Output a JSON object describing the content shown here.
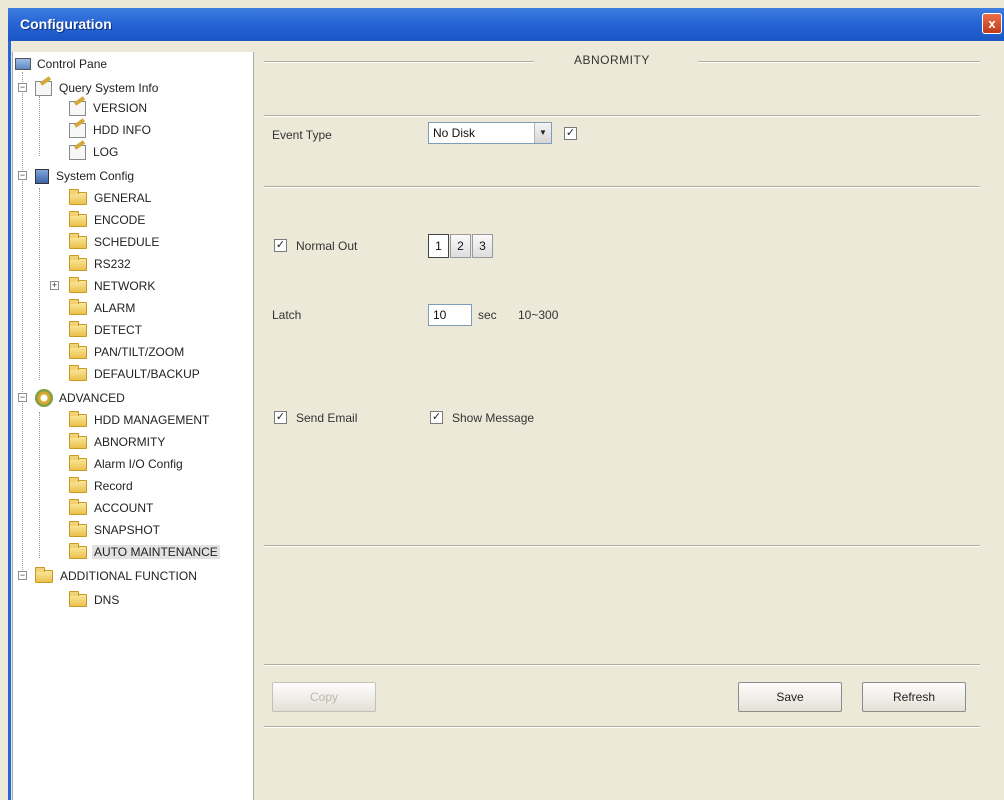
{
  "window": {
    "title": "Configuration",
    "close_label": "x"
  },
  "tree": {
    "items": [
      {
        "label": "Control Pane",
        "icon": "monitor-icon"
      },
      {
        "label": "Query System Info",
        "icon": "note-icon"
      },
      {
        "label": "VERSION",
        "icon": "note-icon"
      },
      {
        "label": "HDD INFO",
        "icon": "note-icon"
      },
      {
        "label": "LOG",
        "icon": "note-icon"
      },
      {
        "label": "System Config",
        "icon": "system-icon"
      },
      {
        "label": "GENERAL",
        "icon": "folder-icon"
      },
      {
        "label": "ENCODE",
        "icon": "folder-icon"
      },
      {
        "label": "SCHEDULE",
        "icon": "folder-icon"
      },
      {
        "label": "RS232",
        "icon": "folder-icon"
      },
      {
        "label": "NETWORK",
        "icon": "folder-icon"
      },
      {
        "label": "ALARM",
        "icon": "folder-icon"
      },
      {
        "label": "DETECT",
        "icon": "folder-icon"
      },
      {
        "label": "PAN/TILT/ZOOM",
        "icon": "folder-icon"
      },
      {
        "label": "DEFAULT/BACKUP",
        "icon": "folder-icon"
      },
      {
        "label": "ADVANCED",
        "icon": "gear-icon"
      },
      {
        "label": "HDD MANAGEMENT",
        "icon": "folder-icon"
      },
      {
        "label": "ABNORMITY",
        "icon": "folder-icon"
      },
      {
        "label": "Alarm I/O Config",
        "icon": "folder-icon"
      },
      {
        "label": "Record",
        "icon": "folder-icon"
      },
      {
        "label": "ACCOUNT",
        "icon": "folder-icon"
      },
      {
        "label": "SNAPSHOT",
        "icon": "folder-icon"
      },
      {
        "label": "AUTO MAINTENANCE",
        "icon": "folder-icon"
      },
      {
        "label": "ADDITIONAL FUNCTION",
        "icon": "folder-icon"
      },
      {
        "label": "DNS",
        "icon": "folder-icon"
      }
    ]
  },
  "panel": {
    "section_title": "ABNORMITY",
    "event_type": {
      "label": "Event Type",
      "value": "No Disk",
      "enabled": true
    },
    "normal_out": {
      "label": "Normal Out",
      "checked": true,
      "channels": [
        "1",
        "2",
        "3"
      ],
      "selected_channel": "1"
    },
    "latch": {
      "label": "Latch",
      "value": "10",
      "unit": "sec",
      "range": "10~300"
    },
    "send_email": {
      "label": "Send Email",
      "checked": true
    },
    "show_message": {
      "label": "Show Message",
      "checked": true
    },
    "buttons": {
      "copy": "Copy",
      "save": "Save",
      "refresh": "Refresh"
    }
  },
  "colors": {
    "titlebar": "#2765d4",
    "window_bg": "#ece9d8"
  }
}
